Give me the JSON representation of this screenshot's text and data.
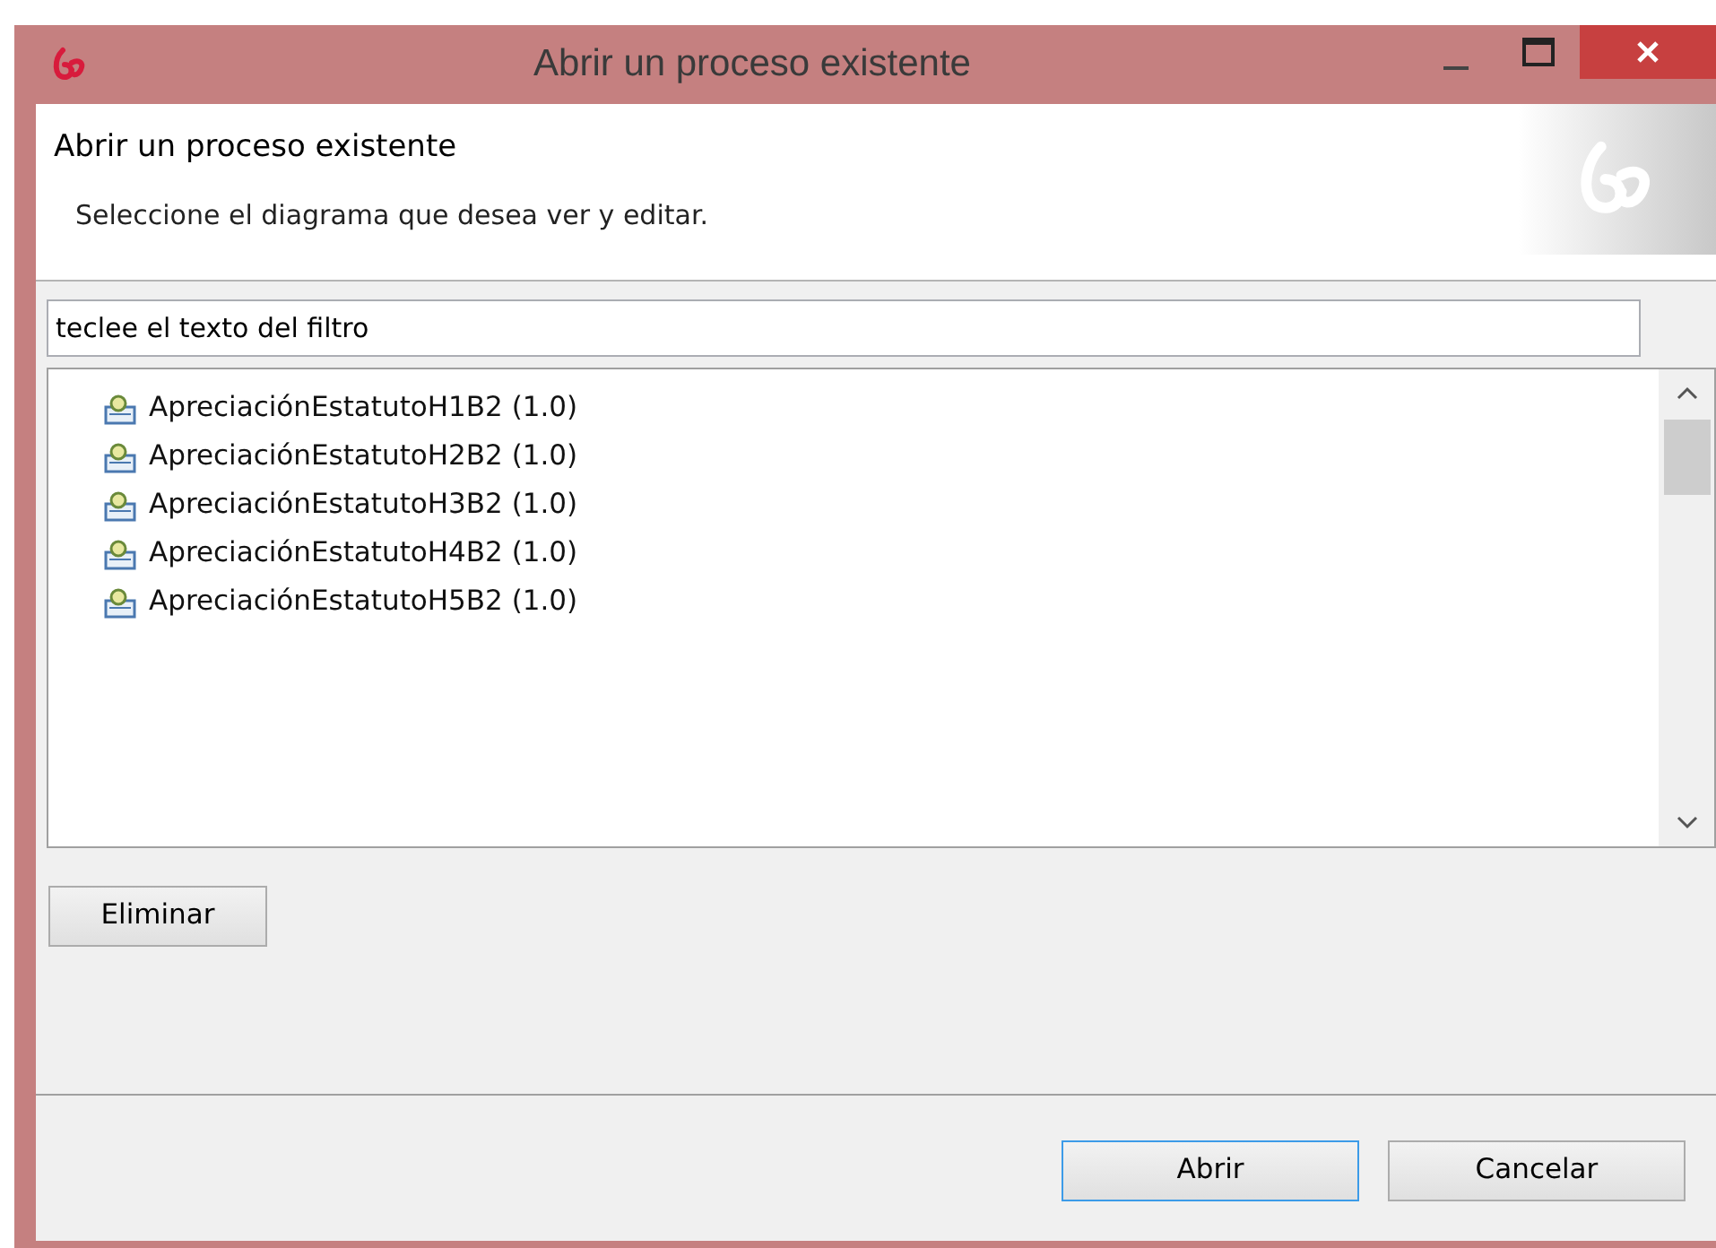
{
  "window": {
    "title": "Abrir un proceso existente"
  },
  "header": {
    "title": "Abrir un proceso existente",
    "description": "Seleccione el diagrama que desea ver y editar."
  },
  "filter": {
    "value": "teclee el texto del filtro"
  },
  "processes": [
    {
      "label": "ApreciaciónEstatutoH1B2 (1.0)",
      "selected": false
    },
    {
      "label": "ApreciaciónEstatutoH2B2 (1.0)",
      "selected": false
    },
    {
      "label": "ApreciaciónEstatutoH3B2 (1.0)",
      "selected": false
    },
    {
      "label": "ApreciaciónEstatutoH4B2 (1.0)",
      "selected": false
    },
    {
      "label": "ApreciaciónEstatutoH5B2 (1.0)",
      "selected": false
    }
  ],
  "delete_button": "Eliminar",
  "buttons": [
    {
      "label": "Abrir",
      "default": true
    },
    {
      "label": "Cancelar",
      "default": false
    }
  ]
}
